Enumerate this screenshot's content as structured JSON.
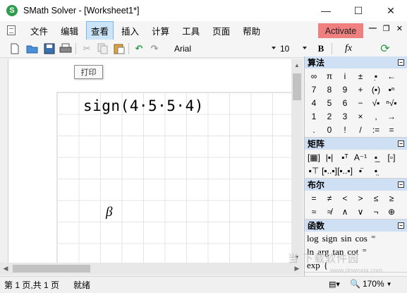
{
  "app": {
    "logo_letter": "S",
    "title": "SMath Solver - [Worksheet1*]",
    "window_controls": [
      "—",
      "☐",
      "✕"
    ]
  },
  "menu": {
    "items": [
      "文件",
      "编辑",
      "查看",
      "插入",
      "计算",
      "工具",
      "页面",
      "帮助"
    ],
    "active": "查看",
    "activate_label": "Activate",
    "mdi_controls": [
      "—",
      "❐",
      "✕"
    ]
  },
  "toolbar": {
    "font": "Arial",
    "size": "10",
    "bold": "B",
    "fx": "fx",
    "icons": [
      "new-icon",
      "open-icon",
      "save-icon",
      "print-icon",
      "cut-icon",
      "copy-icon",
      "paste-icon",
      "undo-icon",
      "redo-icon",
      "calc-icon"
    ]
  },
  "worksheet": {
    "tooltip": "打印",
    "expression": "sign(4·5·5·4)",
    "symbol": "β"
  },
  "panel": {
    "arithmetic": {
      "title": "算法",
      "symbols": [
        "∞",
        "π",
        "i",
        "±",
        "▪̣",
        "←",
        "7",
        "8",
        "9",
        "+",
        "(▪)",
        "▪ⁿ",
        "4",
        "5",
        "6",
        "−",
        "√▪",
        "ⁿ√▪",
        "1",
        "2",
        "3",
        "×",
        ",",
        "→",
        ".",
        "0",
        "!",
        "/",
        ":=",
        "="
      ]
    },
    "matrix": {
      "title": "矩阵",
      "symbols": [
        "[▦]",
        "|▪|",
        "▪ᵀ",
        "A⁻¹",
        "▪̲",
        "[▫]",
        "▪⊤",
        "[▪..▪]",
        "[▪..▪]",
        "▪̈",
        "▪̤"
      ]
    },
    "boolean": {
      "title": "布尔",
      "symbols": [
        "=",
        "≠",
        "<",
        ">",
        "≤",
        "≥",
        "≈",
        "≉",
        "∧",
        "∨",
        "¬",
        "⊕"
      ]
    },
    "functions": {
      "title": "函数",
      "rows": [
        [
          "log",
          "sign",
          "sin",
          "cos",
          "⁼"
        ],
        [
          "ln",
          "arg",
          "tan",
          "cot",
          "⁼"
        ],
        [
          "exp",
          "{"
        ]
      ]
    }
  },
  "statusbar": {
    "page": "第 1 页,共 1 页",
    "status": "就绪",
    "zoom": "170%"
  },
  "watermark": {
    "text": "当 下载软件园",
    "sub": "www.downxia.com"
  }
}
